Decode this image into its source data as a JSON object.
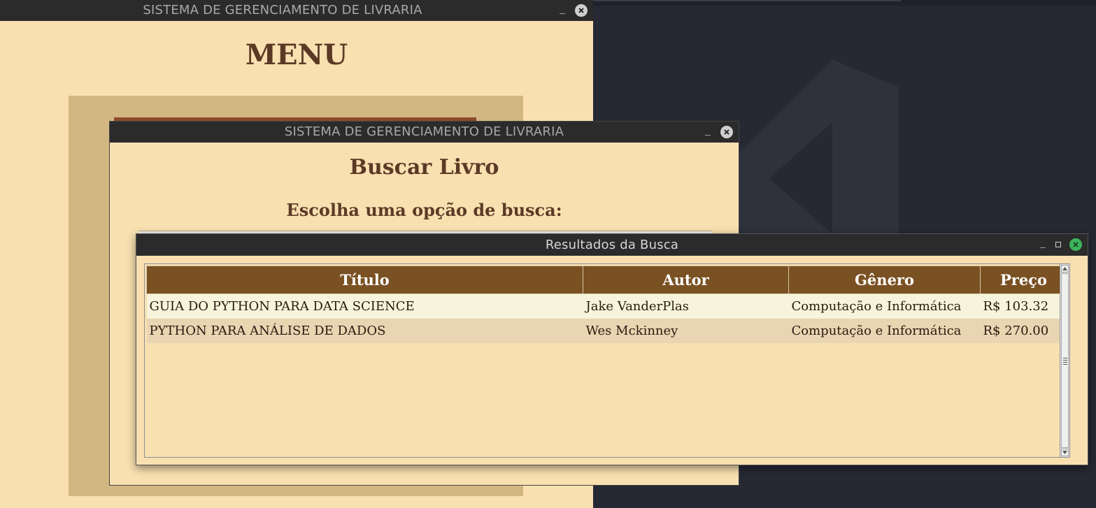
{
  "menu_window": {
    "title": "SISTEMA DE GERENCIAMENTO DE LIVRARIA",
    "heading": "MENU"
  },
  "buscar_window": {
    "title": "SISTEMA DE GERENCIAMENTO DE LIVRARIA",
    "heading": "Buscar Livro",
    "subheading": "Escolha uma opção de busca:"
  },
  "results_window": {
    "title": "Resultados da Busca",
    "columns": [
      "Título",
      "Autor",
      "Gênero",
      "Preço"
    ],
    "rows": [
      [
        "GUIA DO PYTHON PARA DATA SCIENCE",
        "Jake VanderPlas",
        "Computação e Informática",
        "R$ 103.32"
      ],
      [
        "PYTHON PARA ANÁLISE DE DADOS",
        "Wes Mckinney",
        "Computação e Informática",
        "R$ 270.00"
      ]
    ]
  },
  "colors": {
    "window_bg": "#f8e0b1",
    "header_bg": "#7a5123",
    "heading_text": "#5b3a25",
    "row_odd": "#f6f4da",
    "row_even": "#e9d5b2",
    "titlebar": "#2b2b2b",
    "desktop": "#262833"
  },
  "icons": [
    "minimize-icon",
    "maximize-icon",
    "close-icon",
    "app-logo-icon",
    "scroll-up-icon",
    "scroll-down-icon"
  ]
}
